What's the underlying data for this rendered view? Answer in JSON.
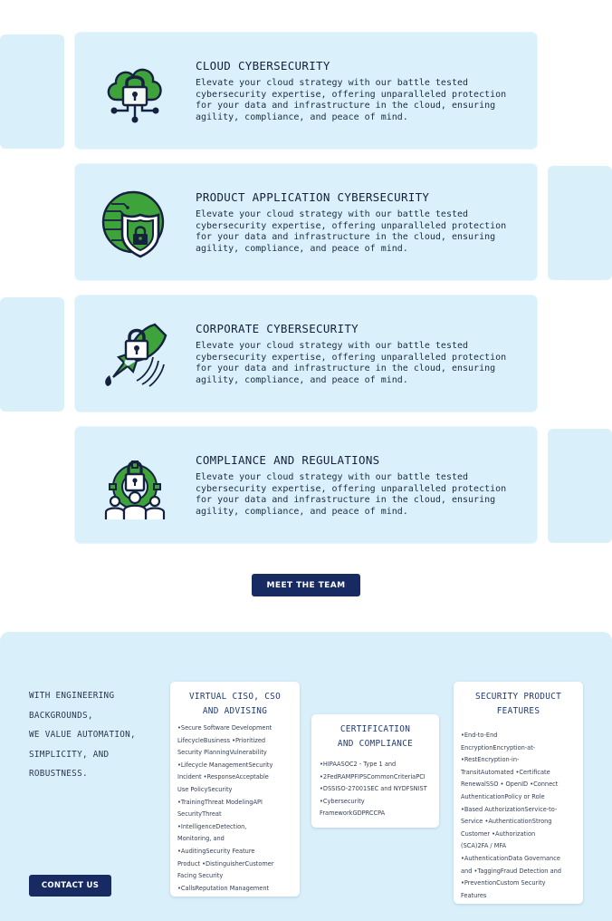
{
  "services": [
    {
      "title": "CLOUD CYBERSECURITY",
      "description": "Elevate your cloud strategy with our battle tested cybersecurity expertise, offering unparalleled protection for your data and infrastructure in the cloud, ensuring agility, compliance, and peace of mind.",
      "icon": "cloud-lock-icon"
    },
    {
      "title": "PRODUCT APPLICATION CYBERSECURITY",
      "description": "Elevate your cloud strategy with our battle tested cybersecurity expertise, offering unparalleled protection for your data and infrastructure in the cloud, ensuring agility, compliance, and peace of mind.",
      "icon": "circuit-shield-icon"
    },
    {
      "title": "CORPORATE CYBERSECURITY",
      "description": "Elevate your cloud strategy with our battle tested cybersecurity expertise, offering unparalleled protection for your data and infrastructure in the cloud, ensuring agility, compliance, and peace of mind.",
      "icon": "rocket-lock-icon"
    },
    {
      "title": "COMPLIANCE AND REGULATIONS",
      "description": "Elevate your cloud strategy with our battle tested cybersecurity expertise, offering unparalleled protection for your data and infrastructure in the cloud, ensuring agility, compliance, and peace of mind.",
      "icon": "team-gear-lock-icon"
    }
  ],
  "meet_team_label": "MEET THE TEAM",
  "footer": {
    "tagline": [
      "WITH ENGINEERING",
      "BACKGROUNDS,",
      "WE VALUE AUTOMATION,",
      "SIMPLICITY, AND",
      "ROBUSTNESS."
    ],
    "contact_label": "CONTACT US",
    "cards": [
      {
        "title": [
          "VIRTUAL CISO, CSO",
          "AND ADVISING"
        ],
        "items": [
          "•Secure Software Development",
          "LifecycleBusiness •Prioritized",
          "Security PlanningVulnerability",
          "•Lifecycle ManagementSecurity",
          "Incident •ResponseAcceptable",
          "Use PolicySecurity",
          "•TrainingThreat ModelingAPI",
          "SecurityThreat",
          "•IntelligenceDetection,",
          "Monitoring, and",
          "•AuditingSecurity Feature",
          "Product •DistinguisherCustomer",
          "Facing Security",
          "•CallsReputation Management"
        ]
      },
      {
        "title": [
          "CERTIFICATION",
          "AND COMPLIANCE"
        ],
        "items": [
          "•HIPAASOC2 - Type 1 and",
          "•2FedRAMPFIPSCommonCriteriaPCI",
          "•DSSISO-27001SEC and NYDFSNIST",
          "•Cybersecurity",
          "FrameworkGDPRCCPA"
        ]
      },
      {
        "title": [
          "SECURITY PRODUCT",
          "FEATURES"
        ],
        "items": [
          "•End-to-End",
          "EncryptionEncryption-at-",
          "•RestEncryption-in-",
          "TransitAutomated •Certificate",
          "RenewalSSO • OpenID •Connect",
          "AuthenticationPolicy or Role",
          "•Based AuthorizationService-to-",
          "Service •AuthenticationStrong",
          "Customer •Authorization",
          "(SCA)2FA / MFA",
          "•AuthenticationData Governance",
          "and •TaggingFraud Detection and",
          "•PreventionCustom Security",
          "Features"
        ]
      }
    ]
  },
  "colors": {
    "navy": "#172b62",
    "card_bg": "#daf1fb",
    "icon_green": "#3da33a",
    "icon_dark": "#16213f"
  }
}
